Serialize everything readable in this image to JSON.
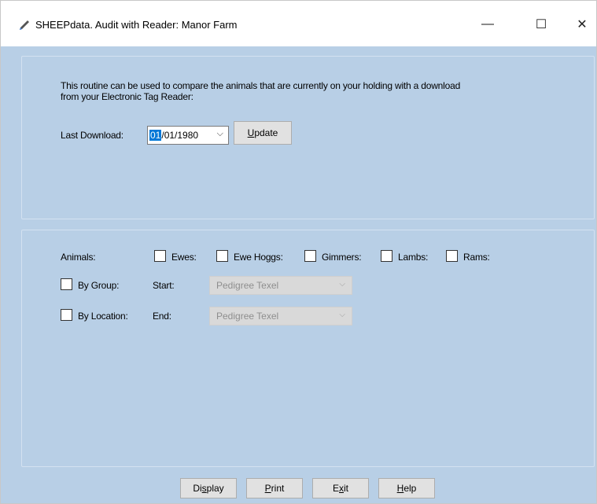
{
  "window": {
    "title": "SHEEPdata. Audit with Reader: Manor Farm",
    "minimize_glyph": "—",
    "maximize_glyph": "☐",
    "close_glyph": "✕"
  },
  "intro": {
    "line1": "This routine can be used to compare the animals that are currently on your holding with a download",
    "line2": "from your Electronic Tag Reader:"
  },
  "download": {
    "label": "Last Download:",
    "date_selected": "01",
    "date_rest": "/01/1980",
    "dropdown_glyph": "⌵",
    "update_prefix": "",
    "update_underlined": "U",
    "update_rest": "pdate"
  },
  "animals": {
    "label": "Animals:",
    "options": [
      {
        "label": "Ewes:",
        "checked": false
      },
      {
        "label": "Ewe Hoggs:",
        "checked": false
      },
      {
        "label": "Gimmers:",
        "checked": false
      },
      {
        "label": "Lambs:",
        "checked": false
      },
      {
        "label": "Rams:",
        "checked": false
      }
    ]
  },
  "filters": {
    "by_group": "By Group:",
    "by_location": "By Location:",
    "start_label": "Start:",
    "end_label": "End:",
    "start_value": "Pedigree Texel",
    "end_value": "Pedigree Texel"
  },
  "buttons": {
    "display_pre": "Di",
    "display_u": "s",
    "display_post": "play",
    "print_pre": "",
    "print_u": "P",
    "print_post": "rint",
    "exit_pre": "E",
    "exit_u": "x",
    "exit_post": "it",
    "help_pre": "",
    "help_u": "H",
    "help_post": "elp"
  },
  "colors": {
    "background": "#b8cfe6",
    "selection": "#0078d7"
  }
}
